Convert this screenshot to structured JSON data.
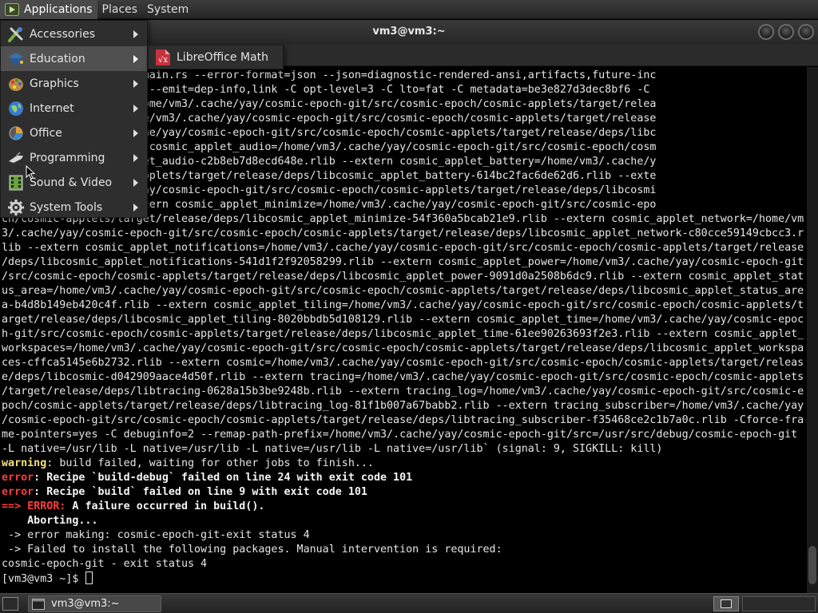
{
  "top_panel": {
    "menus": [
      "Applications",
      "Places",
      "System"
    ]
  },
  "window": {
    "title": "vm3@vm3:~"
  },
  "apps_menu": {
    "items": [
      {
        "label": "Accessories",
        "icon": "accessories-icon"
      },
      {
        "label": "Education",
        "icon": "education-icon"
      },
      {
        "label": "Graphics",
        "icon": "graphics-icon"
      },
      {
        "label": "Internet",
        "icon": "internet-icon"
      },
      {
        "label": "Office",
        "icon": "office-icon"
      },
      {
        "label": "Programming",
        "icon": "programming-icon"
      },
      {
        "label": "Sound & Video",
        "icon": "sound-video-icon"
      },
      {
        "label": "System Tools",
        "icon": "system-tools-icon"
      }
    ],
    "submenu": {
      "label": "LibreOffice Math",
      "icon": "libreoffice-math-icon"
    }
  },
  "terminal": {
    "lines": [
      {
        "parts": [
          {
            "t": "21 cosmic-applets/src/main.rs --error-format=json --json=diagnostic-rendered-ansi,artifacts,future-inc"
          }
        ]
      },
      {
        "parts": [
          {
            "t": "h=125 --crate-type bin --emit=dep-info,link -C opt-level=3 -C lto=fat -C metadata=be3e827d3dec8bf6 -C"
          }
        ]
      },
      {
        "parts": [
          {
            "t": "d3dec8bf6 --out-dir /home/vm3/.cache/yay/cosmic-epoch-git/src/cosmic-epoch/cosmic-applets/target/relea"
          }
        ]
      },
      {
        "parts": [
          {
            "t": "nfo -L dependency=/home/vm3/.cache/yay/cosmic-epoch-git/src/cosmic-epoch/cosmic-applets/target/release"
          }
        ]
      },
      {
        "parts": [
          {
            "t": "pp_list=/home/vm3/.cache/yay/cosmic-epoch-git/src/cosmic-epoch/cosmic-applets/target/release/deps/libc"
          }
        ]
      },
      {
        "parts": [
          {
            "t": "bb4d8336.rlib --extern cosmic_applet_audio=/home/vm3/.cache/yay/cosmic-epoch-git/src/cosmic-epoch/cosm"
          }
        ]
      },
      {
        "parts": [
          {
            "t": "se/deps/libcosmic_applet_audio-c2b8eb7d8ecd648e.rlib --extern cosmic_applet_battery=/home/vm3/.cache/y"
          }
        ]
      },
      {
        "parts": [
          {
            "t": "/cosmic-epoch/cosmic-applets/target/release/deps/libcosmic_applet_battery-614bc2fac6de62d6.rlib --exte"
          }
        ]
      },
      {
        "parts": [
          {
            "t": "oth=/home/vm3/.cache/yay/cosmic-epoch-git/src/cosmic-epoch/cosmic-applets/target/release/deps/libcosmi"
          }
        ]
      },
      {
        "parts": [
          {
            "t": "94d0994a488d.rlib --extern cosmic_applet_minimize=/home/vm3/.cache/yay/cosmic-epoch-git/src/cosmic-epo"
          }
        ]
      },
      {
        "parts": [
          {
            "t": "ch/cosmic-applets/target/release/deps/libcosmic_applet_minimize-54f360a5bcab21e9.rlib --extern cosmic_applet_network=/home/vm"
          }
        ]
      },
      {
        "parts": [
          {
            "t": "3/.cache/yay/cosmic-epoch-git/src/cosmic-epoch/cosmic-applets/target/release/deps/libcosmic_applet_network-c80cce59149cbcc3.r"
          }
        ]
      },
      {
        "parts": [
          {
            "t": "lib --extern cosmic_applet_notifications=/home/vm3/.cache/yay/cosmic-epoch-git/src/cosmic-epoch/cosmic-applets/target/release"
          }
        ]
      },
      {
        "parts": [
          {
            "t": "/deps/libcosmic_applet_notifications-541d1f2f92058299.rlib --extern cosmic_applet_power=/home/vm3/.cache/yay/cosmic-epoch-git"
          }
        ]
      },
      {
        "parts": [
          {
            "t": "/src/cosmic-epoch/cosmic-applets/target/release/deps/libcosmic_applet_power-9091d0a2508b6dc9.rlib --extern cosmic_applet_stat"
          }
        ]
      },
      {
        "parts": [
          {
            "t": "us_area=/home/vm3/.cache/yay/cosmic-epoch-git/src/cosmic-epoch/cosmic-applets/target/release/deps/libcosmic_applet_status_are"
          }
        ]
      },
      {
        "parts": [
          {
            "t": "a-b4d8b149eb420c4f.rlib --extern cosmic_applet_tiling=/home/vm3/.cache/yay/cosmic-epoch-git/src/cosmic-epoch/cosmic-applets/t"
          }
        ]
      },
      {
        "parts": [
          {
            "t": "arget/release/deps/libcosmic_applet_tiling-8020bbdb5d108129.rlib --extern cosmic_applet_time=/home/vm3/.cache/yay/cosmic-epoc"
          }
        ]
      },
      {
        "parts": [
          {
            "t": "h-git/src/cosmic-epoch/cosmic-applets/target/release/deps/libcosmic_applet_time-61ee90263693f2e3.rlib --extern cosmic_applet_"
          }
        ]
      },
      {
        "parts": [
          {
            "t": "workspaces=/home/vm3/.cache/yay/cosmic-epoch-git/src/cosmic-epoch/cosmic-applets/target/release/deps/libcosmic_applet_workspa"
          }
        ]
      },
      {
        "parts": [
          {
            "t": "ces-cffca5145e6b2732.rlib --extern cosmic=/home/vm3/.cache/yay/cosmic-epoch-git/src/cosmic-epoch/cosmic-applets/target/releas"
          }
        ]
      },
      {
        "parts": [
          {
            "t": "e/deps/libcosmic-d042909aace4d50f.rlib --extern tracing=/home/vm3/.cache/yay/cosmic-epoch-git/src/cosmic-epoch/cosmic-applets"
          }
        ]
      },
      {
        "parts": [
          {
            "t": "/target/release/deps/libtracing-0628a15b3be9248b.rlib --extern tracing_log=/home/vm3/.cache/yay/cosmic-epoch-git/src/cosmic-e"
          }
        ]
      },
      {
        "parts": [
          {
            "t": "poch/cosmic-applets/target/release/deps/libtracing_log-81f1b007a67babb2.rlib --extern tracing_subscriber=/home/vm3/.cache/yay"
          }
        ]
      },
      {
        "parts": [
          {
            "t": "/cosmic-epoch-git/src/cosmic-epoch/cosmic-applets/target/release/deps/libtracing_subscriber-f35468ce2c1b7a0c.rlib -Cforce-fra"
          }
        ]
      },
      {
        "parts": [
          {
            "t": "me-pointers=yes -C debuginfo=2 --remap-path-prefix=/home/vm3/.cache/yay/cosmic-epoch-git/src=/usr/src/debug/cosmic-epoch-git"
          }
        ]
      },
      {
        "parts": [
          {
            "t": "-L native=/usr/lib -L native=/usr/lib -L native=/usr/lib -L native=/usr/lib` (signal: 9, SIGKILL: kill)"
          }
        ]
      },
      {
        "parts": [
          {
            "t": "warning",
            "c": "c-warn"
          },
          {
            "t": ": build failed, waiting for other jobs to finish..."
          }
        ]
      },
      {
        "parts": [
          {
            "t": "error",
            "c": "c-err"
          },
          {
            "t": ": Recipe `build-debug` failed on line 24 with exit code 101",
            "c": "c-bold"
          }
        ]
      },
      {
        "parts": [
          {
            "t": "error",
            "c": "c-err"
          },
          {
            "t": ": Recipe `build` failed on line 9 with exit code 101",
            "c": "c-bold"
          }
        ]
      },
      {
        "parts": [
          {
            "t": "==> ERROR:",
            "c": "c-err"
          },
          {
            "t": " A failure occurred in build().",
            "c": "c-bold"
          }
        ]
      },
      {
        "parts": [
          {
            "t": "    Aborting...",
            "c": "c-bold"
          }
        ]
      },
      {
        "parts": [
          {
            "t": " -> error making: cosmic-epoch-git-exit status 4"
          }
        ]
      },
      {
        "parts": [
          {
            "t": " -> Failed to install the following packages. Manual intervention is required:"
          }
        ]
      },
      {
        "parts": [
          {
            "t": "cosmic-epoch-git - exit status 4"
          }
        ]
      },
      {
        "parts": [
          {
            "t": "[vm3@vm3 ~]$ "
          }
        ],
        "cursor": true
      }
    ]
  },
  "taskbar": {
    "task_label": "vm3@vm3:~"
  },
  "colors": {
    "warning": "#f0e27a",
    "error": "#ff3b3b",
    "terminal_bg": "#000000",
    "terminal_fg": "#e6e6e6"
  }
}
